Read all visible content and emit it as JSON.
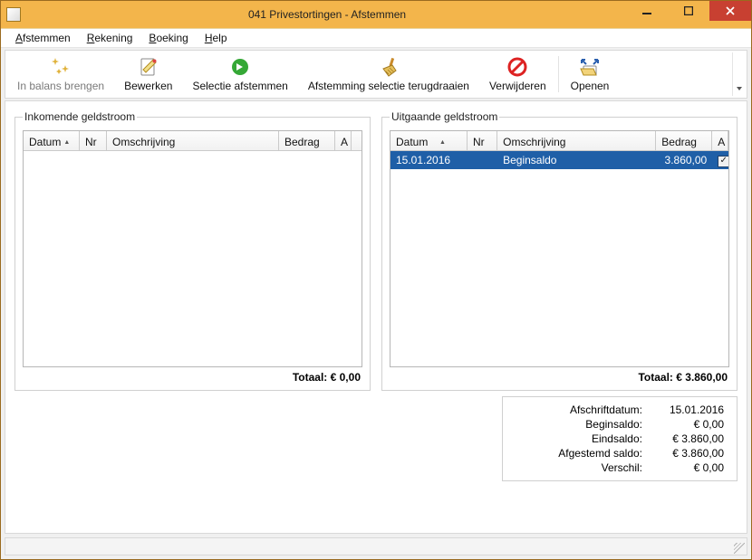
{
  "window": {
    "title": "041 Privestortingen - Afstemmen"
  },
  "menus": {
    "afstemmen": "Afstemmen",
    "rekening": "Rekening",
    "boeking": "Boeking",
    "help": "Help"
  },
  "toolbar": {
    "in_balans": "In balans brengen",
    "bewerken": "Bewerken",
    "selectie_afstemmen": "Selectie afstemmen",
    "selectie_terugdraaien": "Afstemming selectie terugdraaien",
    "verwijderen": "Verwijderen",
    "openen": "Openen"
  },
  "panel_in": {
    "legend": "Inkomende geldstroom",
    "columns": {
      "datum": "Datum",
      "nr": "Nr",
      "omschrijving": "Omschrijving",
      "bedrag": "Bedrag",
      "a": "A"
    },
    "rows": [],
    "total_label": "Totaal:",
    "total_value": "€ 0,00"
  },
  "panel_out": {
    "legend": "Uitgaande geldstroom",
    "columns": {
      "datum": "Datum",
      "nr": "Nr",
      "omschrijving": "Omschrijving",
      "bedrag": "Bedrag",
      "a": "A"
    },
    "rows": [
      {
        "datum": "15.01.2016",
        "nr": "",
        "omschrijving": "Beginsaldo",
        "bedrag": "3.860,00",
        "a": true
      }
    ],
    "total_label": "Totaal:",
    "total_value": "€ 3.860,00"
  },
  "summary": {
    "afschriftdatum_label": "Afschriftdatum:",
    "afschriftdatum_value": "15.01.2016",
    "beginsaldo_label": "Beginsaldo:",
    "beginsaldo_value": "€ 0,00",
    "eindsaldo_label": "Eindsaldo:",
    "eindsaldo_value": "€ 3.860,00",
    "afgestemd_label": "Afgestemd saldo:",
    "afgestemd_value": "€ 3.860,00",
    "verschil_label": "Verschil:",
    "verschil_value": "€ 0,00"
  },
  "sort_indicator": "▲"
}
